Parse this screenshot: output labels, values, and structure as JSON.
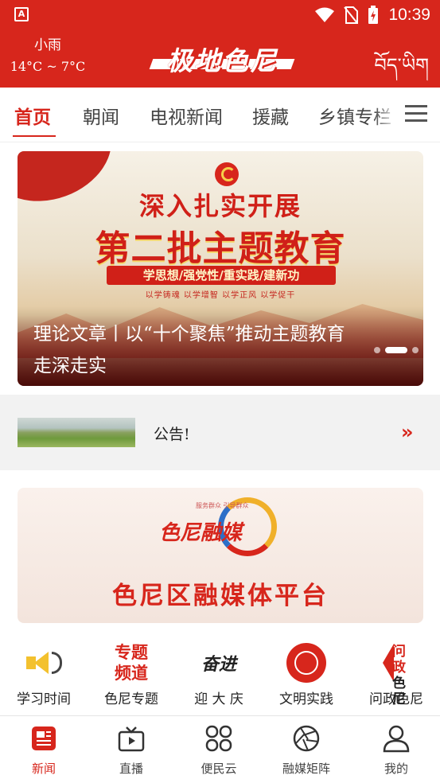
{
  "status_bar": {
    "time": "10:39",
    "notification_icon": "A"
  },
  "header": {
    "weather_condition": "小雨",
    "weather_temp": "14°C ~ 7°C",
    "logo_text": "极地色尼",
    "tibetan_text": "བོད་ཡིག"
  },
  "tabs": [
    {
      "label": "首页",
      "active": true
    },
    {
      "label": "朝闻",
      "active": false
    },
    {
      "label": "电视新闻",
      "active": false
    },
    {
      "label": "援藏",
      "active": false
    },
    {
      "label": "乡镇专栏",
      "active": false
    }
  ],
  "banner": {
    "line1": "深入扎实开展",
    "line2": "第二批主题教育",
    "sub": "学思想/强党性/重实践/建新功",
    "tags": "以学铸魂  以学增智  以学正风  以学促干",
    "caption": "理论文章丨以“十个聚焦”推动主题教育走深走实",
    "active_slide": 2,
    "slide_count": 3
  },
  "notice": {
    "text": "公告!",
    "arrow": "»"
  },
  "promo": {
    "top_text": "服务群众 引导群众",
    "logo_text": "色尼融媒",
    "title": "色尼区融媒体平台"
  },
  "quick_nav": [
    {
      "label": "学习时间",
      "icon": "speaker-icon"
    },
    {
      "label": "色尼专题",
      "icon": "special-topic-icon",
      "icon_text_1": "专题",
      "icon_text_2": "频道"
    },
    {
      "label": "迎 大 庆",
      "icon": "celebration-icon",
      "icon_text": "奋进"
    },
    {
      "label": "文明实践",
      "icon": "civilization-emblem-icon"
    },
    {
      "label": "问政色尼",
      "icon": "inquiry-icon",
      "icon_text_1": "问政",
      "icon_text_2": "色尼"
    }
  ],
  "bottom_nav": [
    {
      "label": "新闻",
      "active": true
    },
    {
      "label": "直播",
      "active": false
    },
    {
      "label": "便民云",
      "active": false
    },
    {
      "label": "融媒矩阵",
      "active": false
    },
    {
      "label": "我的",
      "active": false
    }
  ],
  "colors": {
    "brand_red": "#d7261c",
    "gold": "#f3c12e"
  }
}
